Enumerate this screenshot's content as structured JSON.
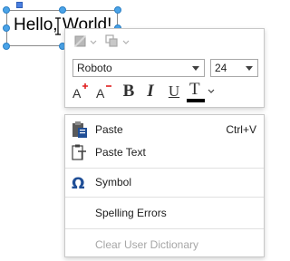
{
  "shape": {
    "text": "Hello, World!"
  },
  "mini_toolbar": {
    "font_name": "Roboto",
    "font_size": "24",
    "increase_font_icon": "font-size-increase-icon",
    "decrease_font_icon": "font-size-decrease-icon",
    "bold_label": "B",
    "italic_label": "I",
    "underline_label": "U",
    "font_color_label": "T",
    "font_color": "#000000"
  },
  "context_menu": {
    "items": [
      {
        "label": "Paste",
        "shortcut": "Ctrl+V",
        "icon": "paste-icon",
        "enabled": true
      },
      {
        "label": "Paste Text",
        "shortcut": "",
        "icon": "paste-text-icon",
        "enabled": true
      },
      {
        "label": "Symbol",
        "shortcut": "",
        "icon": "omega-icon",
        "enabled": true
      },
      {
        "label": "Spelling Errors",
        "shortcut": "",
        "icon": "",
        "enabled": true
      },
      {
        "label": "Clear User Dictionary",
        "shortcut": "",
        "icon": "",
        "enabled": false
      }
    ]
  },
  "colors": {
    "selection_handle": "#4aa3e8",
    "menu_border": "#c8c8c8",
    "disabled_text": "#a6a6a6",
    "font_color_swatch": "#000000",
    "increase_plus": "#e02020",
    "icon_blue": "#1f4e96"
  }
}
